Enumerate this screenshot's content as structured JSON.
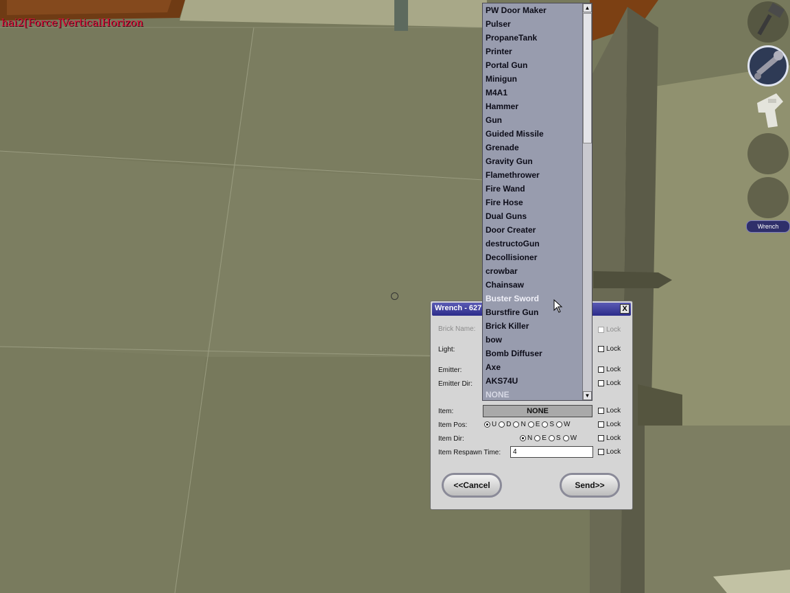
{
  "hud": {
    "player_name": "hai2[Force]VerticalHorizon",
    "tool_label": "Wrench"
  },
  "dialog": {
    "title": "Wrench - 627",
    "close_label": "X",
    "fields": {
      "brick_name_label": "Brick Name:",
      "light_label": "Light:",
      "emitter_label": "Emitter:",
      "emitter_dir_label": "Emitter Dir:",
      "item_label": "Item:",
      "item_pos_label": "Item Pos:",
      "item_dir_label": "Item Dir:",
      "item_respawn_label": "Item Respawn Time:"
    },
    "lock_label": "Lock",
    "item_value": "NONE",
    "item_pos_options": [
      "U",
      "D",
      "N",
      "E",
      "S",
      "W"
    ],
    "item_pos_selected": "U",
    "item_dir_options": [
      "N",
      "E",
      "S",
      "W"
    ],
    "item_dir_selected": "N",
    "respawn_value": "4",
    "cancel_label": "<<Cancel",
    "send_label": "Send>>"
  },
  "dropdown": {
    "items": [
      "PW Door Maker",
      "Pulser",
      "PropaneTank",
      "Printer",
      "Portal Gun",
      "Minigun",
      "M4A1",
      "Hammer",
      "Gun",
      "Guided Missile",
      "Grenade",
      "Gravity Gun",
      "Flamethrower",
      "Fire Wand",
      "Fire Hose",
      "Dual Guns",
      "Door Creater",
      "destructoGun",
      "Decollisioner",
      "crowbar",
      "Chainsaw",
      "Buster Sword",
      "Burstfire Gun",
      "Brick Killer",
      "bow",
      "Bomb Diffuser",
      "Axe",
      "AKS74U",
      "NONE"
    ],
    "hovered": "Buster Sword",
    "selected": "NONE"
  },
  "colors": {
    "player_name": "#e0103a",
    "title_bar": "#3c3ca0",
    "dropdown_bg": "#989cae"
  },
  "icons": [
    "hammer-icon",
    "wrench-icon",
    "spray-can-icon",
    "close-icon",
    "scroll-up-icon",
    "scroll-down-icon",
    "mouse-cursor-icon",
    "crosshair-icon"
  ]
}
